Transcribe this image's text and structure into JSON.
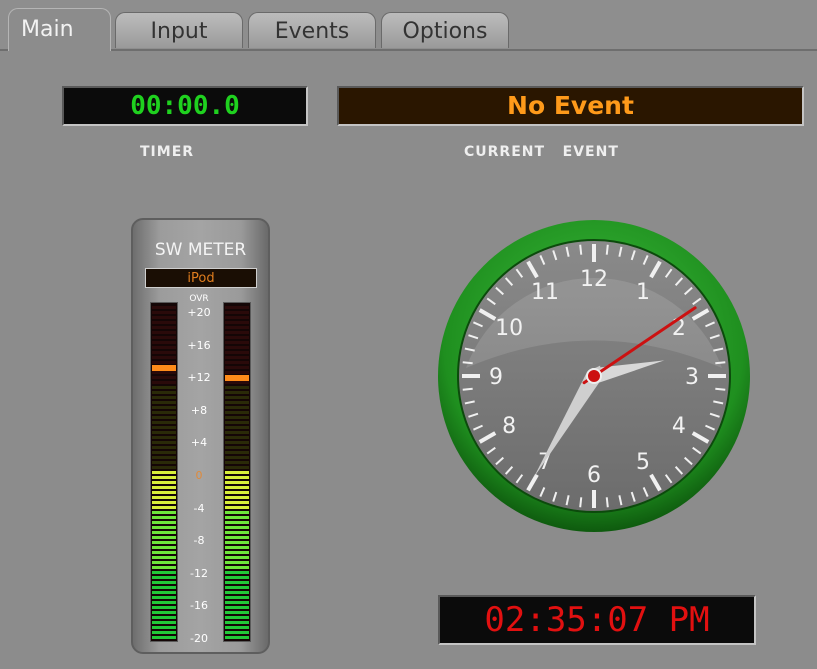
{
  "tabs": [
    {
      "label": "Main",
      "active": true
    },
    {
      "label": "Input",
      "active": false
    },
    {
      "label": "Events",
      "active": false
    },
    {
      "label": "Options",
      "active": false
    }
  ],
  "timer": {
    "value": "00:00.0",
    "caption": "TIMER"
  },
  "current_event": {
    "value": "No Event",
    "caption": "CURRENT   EVENT"
  },
  "meter": {
    "title": "SW METER",
    "source": "iPod",
    "over_label": "OVR",
    "scale": [
      "+20",
      "+16",
      "+12",
      "+8",
      "+4",
      "0",
      "-4",
      "-8",
      "-12",
      "-16",
      "-20"
    ],
    "left_level_fraction": 0.5,
    "right_level_fraction": 0.5,
    "left_peak_fraction": 0.8,
    "right_peak_fraction": 0.77
  },
  "clock": {
    "numbers": [
      "12",
      "1",
      "2",
      "3",
      "4",
      "5",
      "6",
      "7",
      "8",
      "9",
      "10",
      "11"
    ],
    "hour": 2,
    "minute": 35,
    "second": 7,
    "digital": "02:35:07 PM",
    "ring_color": "#2a9a2a",
    "second_hand_color": "#cc1111"
  }
}
